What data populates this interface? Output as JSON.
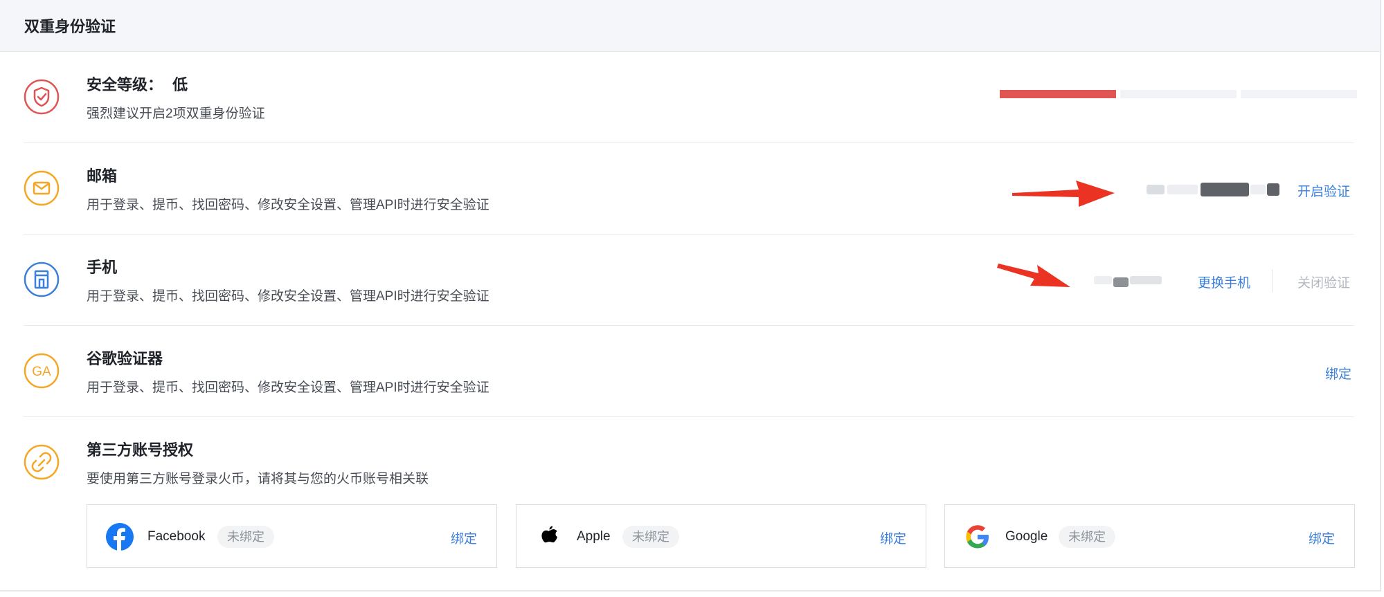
{
  "page": {
    "title": "双重身份验证"
  },
  "security": {
    "title": "安全等级：",
    "level": "低",
    "desc": "强烈建议开启2项双重身份验证",
    "level_fraction": 0.33,
    "color": "#e05454"
  },
  "email": {
    "title": "邮箱",
    "desc": "用于登录、提币、找回密码、修改安全设置、管理API时进行安全验证",
    "action": "开启验证",
    "icon": "mail-icon",
    "color": "#f5a623"
  },
  "phone": {
    "title": "手机",
    "desc": "用于登录、提币、找回密码、修改安全设置、管理API时进行安全验证",
    "change": "更换手机",
    "disable": "关闭验证",
    "icon": "phone-icon",
    "color": "#3b7fdc"
  },
  "google_auth": {
    "title": "谷歌验证器",
    "desc": "用于登录、提币、找回密码、修改安全设置、管理API时进行安全验证",
    "action": "绑定",
    "icon_text": "GA",
    "color": "#f5a623"
  },
  "third_party": {
    "title": "第三方账号授权",
    "desc": "要使用第三方账号登录火币，请将其与您的火币账号相关联",
    "icon": "link-icon",
    "accounts": [
      {
        "name": "Facebook",
        "status": "未绑定",
        "action": "绑定",
        "icon": "facebook-logo-icon",
        "color": "#1877f2"
      },
      {
        "name": "Apple",
        "status": "未绑定",
        "action": "绑定",
        "icon": "apple-logo-icon",
        "color": "#000000"
      },
      {
        "name": "Google",
        "status": "未绑定",
        "action": "绑定",
        "icon": "google-logo-icon",
        "color": "#4285f4"
      }
    ]
  },
  "accent": "#3b7fdc"
}
